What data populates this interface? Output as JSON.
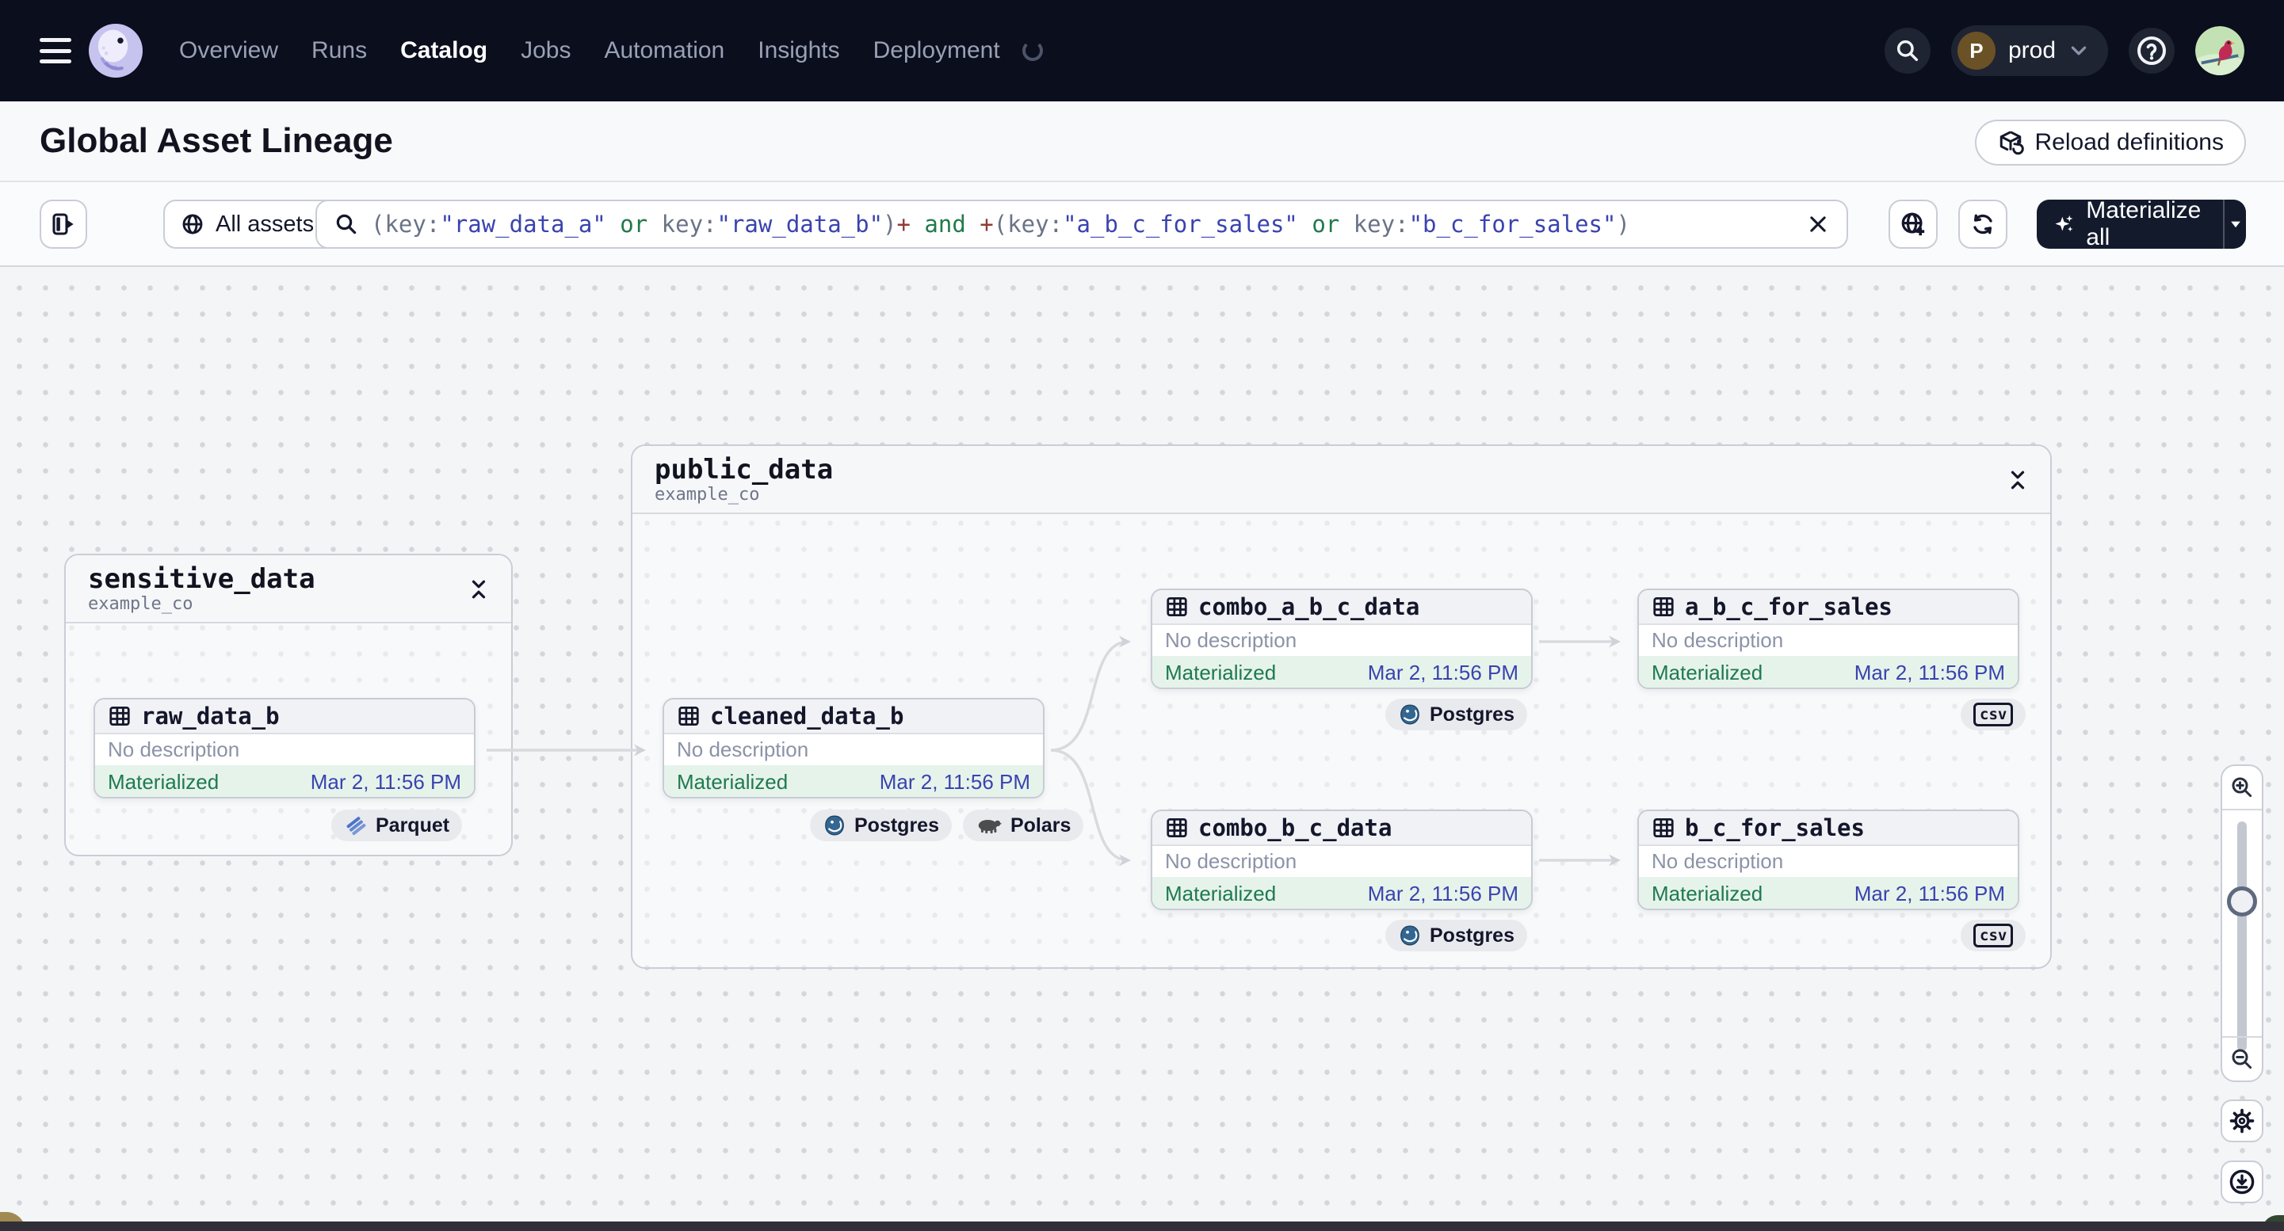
{
  "nav": {
    "items": [
      {
        "label": "Overview"
      },
      {
        "label": "Runs"
      },
      {
        "label": "Catalog"
      },
      {
        "label": "Jobs"
      },
      {
        "label": "Automation"
      },
      {
        "label": "Insights"
      },
      {
        "label": "Deployment"
      }
    ],
    "environment": {
      "initial": "P",
      "name": "prod"
    }
  },
  "header": {
    "title": "Global Asset Lineage",
    "reload_label": "Reload definitions"
  },
  "toolbar": {
    "scope_label": "All assets",
    "materialize_label": "Materialize all",
    "query_segments": [
      {
        "text": "(key:"
      },
      {
        "text": "\"raw_data_a\""
      },
      {
        "text": " or "
      },
      {
        "text": "key:"
      },
      {
        "text": "\"raw_data_b\""
      },
      {
        "text": ")"
      },
      {
        "text": "+"
      },
      {
        "text": " and "
      },
      {
        "text": "+"
      },
      {
        "text": "(key:"
      },
      {
        "text": "\"a_b_c_for_sales\""
      },
      {
        "text": " or "
      },
      {
        "text": "key:"
      },
      {
        "text": "\"b_c_for_sales\""
      },
      {
        "text": ")"
      }
    ]
  },
  "graph": {
    "groups": [
      {
        "name": "sensitive_data",
        "repo": "example_co"
      },
      {
        "name": "public_data",
        "repo": "example_co"
      }
    ],
    "nodes": [
      {
        "name": "raw_data_b",
        "desc": "No description",
        "status": "Materialized",
        "timestamp": "Mar 2, 11:56 PM"
      },
      {
        "name": "cleaned_data_b",
        "desc": "No description",
        "status": "Materialized",
        "timestamp": "Mar 2, 11:56 PM"
      },
      {
        "name": "combo_a_b_c_data",
        "desc": "No description",
        "status": "Materialized",
        "timestamp": "Mar 2, 11:56 PM"
      },
      {
        "name": "a_b_c_for_sales",
        "desc": "No description",
        "status": "Materialized",
        "timestamp": "Mar 2, 11:56 PM"
      },
      {
        "name": "combo_b_c_data",
        "desc": "No description",
        "status": "Materialized",
        "timestamp": "Mar 2, 11:56 PM"
      },
      {
        "name": "b_c_for_sales",
        "desc": "No description",
        "status": "Materialized",
        "timestamp": "Mar 2, 11:56 PM"
      }
    ],
    "badges": {
      "parquet": "Parquet",
      "postgres": "Postgres",
      "polars": "Polars",
      "csv": "csv"
    }
  },
  "colors": {
    "nav_bg": "#0a0e1d",
    "accent_indigo": "#3a43ae",
    "status_green": "#1f7a4e",
    "operator_red": "#8f3b36",
    "slate": "#6a7387",
    "edge_gray": "#d8dade",
    "materialized_bg": "#e6f3eb"
  }
}
